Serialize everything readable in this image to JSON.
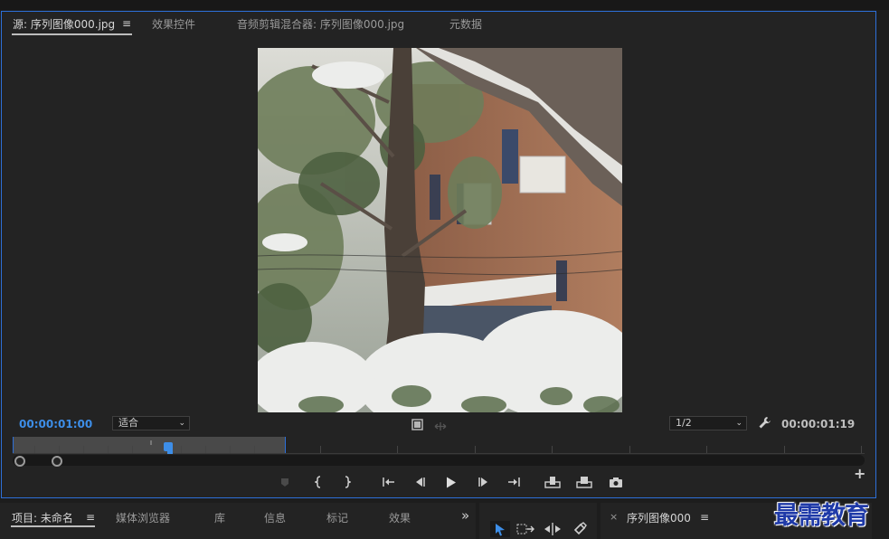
{
  "monitor": {
    "tabs": [
      {
        "label": "源: 序列图像000.jpg",
        "active": true
      },
      {
        "label": "效果控件"
      },
      {
        "label": "音频剪辑混合器: 序列图像000.jpg"
      },
      {
        "label": "元数据"
      }
    ],
    "menu_glyph": "≡",
    "timecode_in": "00:00:01:00",
    "fit_select": "适合",
    "resolution_select": "1/2",
    "timecode_duration": "00:00:01:19"
  },
  "bottom": {
    "project_tabs": [
      {
        "label": "项目: 未命名",
        "active": true
      },
      {
        "label": "媒体浏览器"
      },
      {
        "label": "库"
      },
      {
        "label": "信息"
      },
      {
        "label": "标记"
      },
      {
        "label": "效果"
      }
    ],
    "overflow_glyph": "»",
    "sequence_tab": "序列图像000",
    "close_glyph": "×",
    "menu_glyph": "≡"
  },
  "watermark": "最需教育",
  "colors": {
    "accent": "#2d6fd8",
    "timecode": "#3d8ee8",
    "panel": "#232323"
  },
  "icons": [
    "marker-icon",
    "mark-in-icon",
    "mark-out-icon",
    "go-to-in-icon",
    "step-back-icon",
    "play-icon",
    "step-forward-icon",
    "go-to-out-icon",
    "insert-icon",
    "overwrite-icon",
    "export-frame-icon",
    "wrench-icon",
    "film-icon",
    "add-icon",
    "selection-tool-icon",
    "track-select-tool-icon",
    "ripple-edit-tool-icon",
    "razor-tool-icon"
  ]
}
